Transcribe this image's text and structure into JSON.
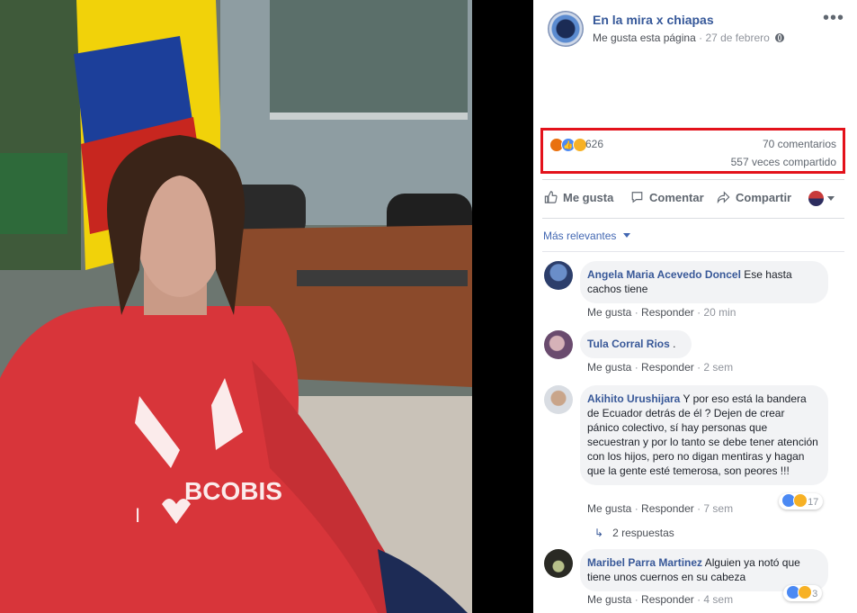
{
  "post": {
    "page_name": "En la mira x chiapas",
    "like_link": "Me gusta esta página",
    "separator": "·",
    "date": "27 de febrero",
    "more_icon": "•••"
  },
  "stats": {
    "reactions_count": "626",
    "comments": "70 comentarios",
    "shares": "557 veces compartido"
  },
  "actions": {
    "like": "Me gusta",
    "comment": "Comentar",
    "share": "Compartir"
  },
  "sort": {
    "label": "Más relevantes"
  },
  "comments": [
    {
      "author": "Angela Maria Acevedo Doncel",
      "text": "Ese hasta cachos tiene",
      "like": "Me gusta",
      "reply": "Responder",
      "time": "20 min"
    },
    {
      "author": "Tula Corral Rios",
      "text": ".",
      "like": "Me gusta",
      "reply": "Responder",
      "time": "2 sem"
    },
    {
      "author": "Akihito Urushijara",
      "text": "Y por eso está la bandera de Ecuador detrás de él ? Dejen de crear pánico colectivo, sí hay personas que secuestran y por lo tanto se debe tener atención con los hijos, pero no digan mentiras y hagan que la gente esté temerosa, son peores !!!",
      "like": "Me gusta",
      "reply": "Responder",
      "time": "7 sem",
      "reactions": "17",
      "replies": "2 respuestas"
    },
    {
      "author": "Maribel Parra Martinez",
      "text": "Alguien ya notó que tiene unos cuernos en su cabeza",
      "like": "Me gusta",
      "reply": "Responder",
      "time": "4 sem",
      "reactions": "3"
    }
  ]
}
